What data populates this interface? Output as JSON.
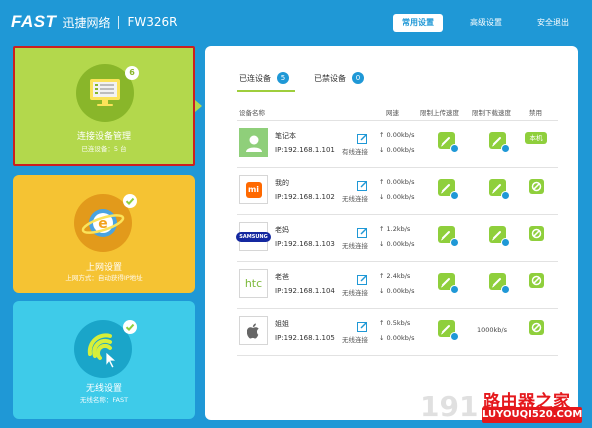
{
  "header": {
    "brand": "FAST",
    "brand_cn": "迅捷网络",
    "model": "FW326R",
    "nav": [
      "常用设置",
      "高级设置",
      "安全退出"
    ]
  },
  "cards": {
    "manage": {
      "title": "连接设备管理",
      "subtitle": "已连设备：5 台",
      "badge": "6"
    },
    "internet": {
      "title": "上网设置",
      "subtitle": "上网方式：自动获得IP地址"
    },
    "wireless": {
      "title": "无线设置",
      "subtitle": "无线名称：FAST"
    }
  },
  "tabs": [
    {
      "label": "已连设备",
      "count": "5"
    },
    {
      "label": "已禁设备",
      "count": "0"
    }
  ],
  "table": {
    "headers": [
      "设备名称",
      "网速",
      "限制上传速度",
      "限制下载速度",
      "禁用"
    ],
    "rows": [
      {
        "name": "笔记本",
        "ip": "IP:192.168.1.101",
        "conn": "有线连接",
        "up": "↑ 0.00kb/s",
        "down": "↓ 0.00kb/s",
        "icon": "computer-icon",
        "host": "本机"
      },
      {
        "name": "我的",
        "ip": "IP:192.168.1.102",
        "conn": "无线连接",
        "up": "↑ 0.00kb/s",
        "down": "↓ 0.00kb/s",
        "icon": "mi-logo-icon"
      },
      {
        "name": "老妈",
        "ip": "IP:192.168.1.103",
        "conn": "无线连接",
        "up": "↑ 1.2kb/s",
        "down": "↓ 0.00kb/s",
        "icon": "samsung-logo-icon"
      },
      {
        "name": "老爸",
        "ip": "IP:192.168.1.104",
        "conn": "无线连接",
        "up": "↑ 2.4kb/s",
        "down": "↓ 0.00kb/s",
        "icon": "htc-logo-icon"
      },
      {
        "name": "姐姐",
        "ip": "IP:192.168.1.105",
        "conn": "无线连接",
        "up": "↑ 0.5kb/s",
        "down": "↓ 0.00kb/s",
        "icon": "apple-logo-icon",
        "download_limit": "1000kb/s"
      }
    ]
  },
  "logos": {
    "mi": "mi",
    "samsung": "SAMSUNG",
    "htc": "htc"
  },
  "watermark": {
    "number": "191",
    "site": "路由器之家",
    "url": "LUYOUQI520.COM"
  },
  "colors": {
    "header": "#1f98d6",
    "manage": "#b3d84c",
    "internet": "#f5c333",
    "wireless": "#3ecbe9",
    "accent_green": "#8fcf3c"
  }
}
